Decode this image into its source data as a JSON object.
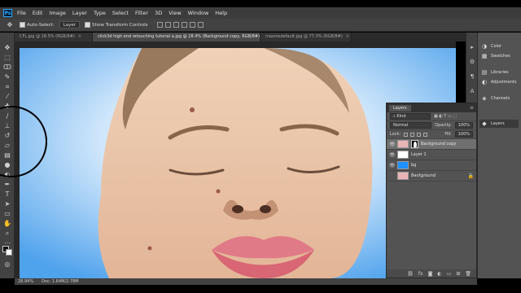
{
  "app": {
    "logo": "Ps"
  },
  "menu": [
    "File",
    "Edit",
    "Image",
    "Layer",
    "Type",
    "Select",
    "Filter",
    "3D",
    "View",
    "Window",
    "Help"
  ],
  "options": {
    "move_icon": "move-icon",
    "auto_select_label": "Auto-Select:",
    "auto_select_value": "Layer",
    "transform_label": "Show Transform Controls"
  },
  "tabs": [
    {
      "label": "CFL.jpg @ 28.5% (RGB/8#)",
      "close": "×"
    },
    {
      "label": "click3d high end retouching tutorial a.jpg @ 28.4% (Background copy, RGB/8#)",
      "close": "×"
    },
    {
      "label": "maxresdefault.jpg @ 77.3% (RGB/8#)",
      "close": "×"
    }
  ],
  "status": {
    "zoom": "28.94%",
    "doc": "Doc: 1.64M/2.78M"
  },
  "layers_panel": {
    "tab": "Layers",
    "kind_label": "Kind",
    "blend_mode": "Normal",
    "opacity_label": "Opacity:",
    "opacity_value": "100%",
    "lock_label": "Lock:",
    "fill_label": "Fill:",
    "fill_value": "100%",
    "layers": [
      {
        "name": "Background copy",
        "selected": true,
        "visible": true,
        "thumb_color": "#e8b4b8",
        "has_mask": true
      },
      {
        "name": "Layer 1",
        "selected": false,
        "visible": true,
        "thumb_color": "#ffffff",
        "has_mask": false
      },
      {
        "name": "bg",
        "selected": false,
        "visible": true,
        "thumb_color": "#1e90ff",
        "has_mask": false
      },
      {
        "name": "Background",
        "selected": false,
        "visible": false,
        "thumb_color": "#e8b4b8",
        "has_mask": false,
        "locked": true
      }
    ],
    "footer_icons": [
      "link-icon",
      "fx-icon",
      "mask-icon",
      "adjustment-icon",
      "folder-icon",
      "new-layer-icon",
      "trash-icon"
    ]
  },
  "dock": {
    "items": [
      {
        "label": "Color",
        "icon": "color-icon"
      },
      {
        "label": "Swatches",
        "icon": "swatches-icon"
      },
      {
        "label": "Libraries",
        "icon": "libraries-icon"
      },
      {
        "label": "Adjustments",
        "icon": "adjustments-icon"
      },
      {
        "label": "Channels",
        "icon": "channels-icon"
      },
      {
        "label": "Layers",
        "icon": "layers-icon"
      }
    ]
  },
  "colors": {
    "canvas_bg": "#5aa8ee",
    "skin": "#e9c2a3",
    "lips": "#e07a86",
    "hair": "#8a6a4d",
    "panel": "#535353"
  }
}
